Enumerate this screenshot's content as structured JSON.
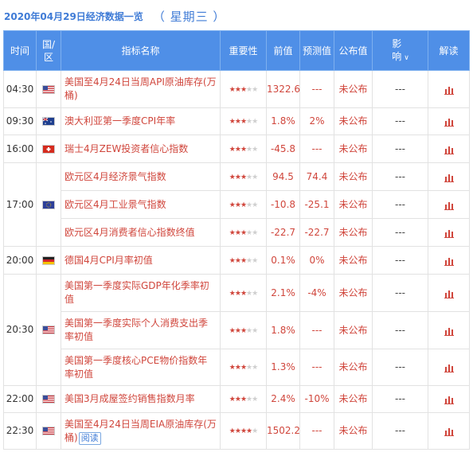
{
  "header": {
    "date": "2020年04月29日经济数据一览",
    "weekday": "（ 星期三 ）"
  },
  "columns": {
    "time": "时间",
    "country": "国/区",
    "name": "指标名称",
    "importance": "重要性",
    "previous": "前值",
    "forecast": "预测值",
    "actual": "公布值",
    "impact": "影响",
    "interpret": "解读"
  },
  "accent": "#4f8fe7",
  "red": "#d0463c",
  "groups": [
    {
      "time": "04:30",
      "flag": "us",
      "rows": [
        {
          "name": "美国至4月24日当周API原油库存(万桶)",
          "stars": 3,
          "previous": "1322.6",
          "forecast": "---",
          "actual": "未公布",
          "impact": "---"
        }
      ]
    },
    {
      "time": "09:30",
      "flag": "au",
      "rows": [
        {
          "name": "澳大利亚第一季度CPI年率",
          "stars": 3,
          "previous": "1.8%",
          "forecast": "2%",
          "actual": "未公布",
          "impact": "---"
        }
      ]
    },
    {
      "time": "16:00",
      "flag": "ch",
      "rows": [
        {
          "name": "瑞士4月ZEW投资者信心指数",
          "stars": 3,
          "previous": "-45.8",
          "forecast": "---",
          "actual": "未公布",
          "impact": "---"
        }
      ]
    },
    {
      "time": "17:00",
      "flag": "eu",
      "rows": [
        {
          "name": "欧元区4月经济景气指数",
          "stars": 3,
          "previous": "94.5",
          "forecast": "74.4",
          "actual": "未公布",
          "impact": "---"
        },
        {
          "name": "欧元区4月工业景气指数",
          "stars": 3,
          "previous": "-10.8",
          "forecast": "-25.1",
          "actual": "未公布",
          "impact": "---"
        },
        {
          "name": "欧元区4月消费者信心指数终值",
          "stars": 3,
          "previous": "-22.7",
          "forecast": "-22.7",
          "actual": "未公布",
          "impact": "---"
        }
      ]
    },
    {
      "time": "20:00",
      "flag": "de",
      "rows": [
        {
          "name": "德国4月CPI月率初值",
          "stars": 3,
          "previous": "0.1%",
          "forecast": "0%",
          "actual": "未公布",
          "impact": "---"
        }
      ]
    },
    {
      "time": "20:30",
      "flag": "us",
      "rows": [
        {
          "name": "美国第一季度实际GDP年化季率初值",
          "stars": 3,
          "previous": "2.1%",
          "forecast": "-4%",
          "actual": "未公布",
          "impact": "---"
        },
        {
          "name": "美国第一季度实际个人消费支出季率初值",
          "stars": 3,
          "previous": "1.8%",
          "forecast": "---",
          "actual": "未公布",
          "impact": "---"
        },
        {
          "name": "美国第一季度核心PCE物价指数年率初值",
          "stars": 3,
          "previous": "1.3%",
          "forecast": "---",
          "actual": "未公布",
          "impact": "---"
        }
      ]
    },
    {
      "time": "22:00",
      "flag": "us",
      "rows": [
        {
          "name": "美国3月成屋签约销售指数月率",
          "stars": 3,
          "previous": "2.4%",
          "forecast": "-10%",
          "actual": "未公布",
          "impact": "---"
        }
      ]
    },
    {
      "time": "22:30",
      "flag": "us",
      "rows": [
        {
          "name": "美国至4月24日当周EIA原油库存(万桶)",
          "stars": 4,
          "previous": "1502.2",
          "forecast": "---",
          "actual": "未公布",
          "impact": "---",
          "read_label": "阅读"
        }
      ]
    }
  ]
}
